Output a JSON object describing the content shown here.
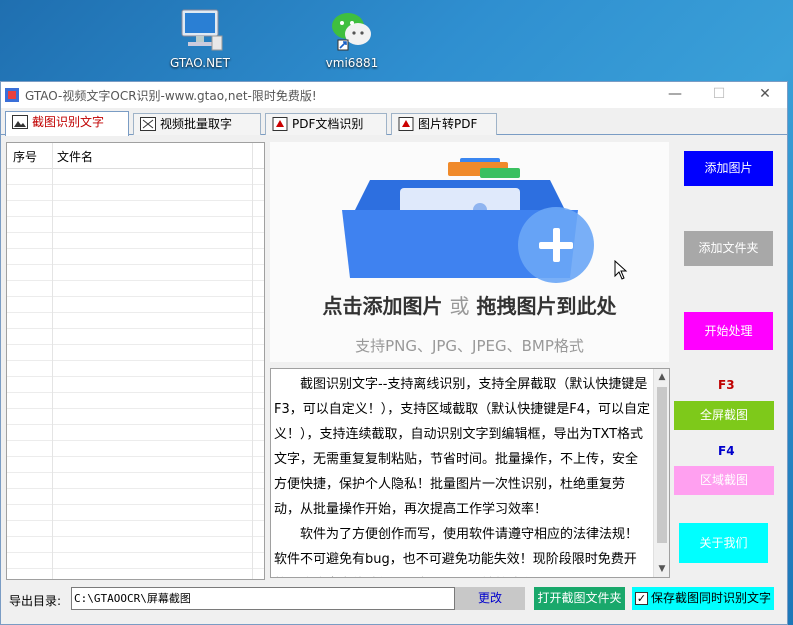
{
  "desktop": {
    "icons": [
      {
        "name": "computer-icon",
        "label": "GTAO.NET"
      },
      {
        "name": "wechat-icon",
        "label": "vmi6881"
      }
    ]
  },
  "window": {
    "title": "GTAO-视频文字OCR识别-www.gtao,net-限时免费版!",
    "controls": {
      "minimize": "—",
      "maximize": "☐",
      "close": "✕"
    }
  },
  "tabs": [
    {
      "label": "截图识别文字",
      "active": true
    },
    {
      "label": "视频批量取字",
      "active": false
    },
    {
      "label": "PDF文档识别",
      "active": false
    },
    {
      "label": "图片转PDF",
      "active": false
    }
  ],
  "filelist": {
    "col_index": "序号",
    "col_name": "文件名"
  },
  "dropzone": {
    "main_left": "点击添加图片",
    "main_or": "或",
    "main_right": "拖拽图片到此处",
    "sub": "支持PNG、JPG、JPEG、BMP格式"
  },
  "description": {
    "p1": "截图识别文字--支持离线识别，支持全屏截取（默认快捷键是F3，可以自定义！），支持区域截取（默认快捷键是F4，可以自定义！），支持连续截取，自动识别文字到编辑框，导出为TXT格式文字，无需重复复制粘贴，节省时间。批量操作，不上传，安全方便快捷，保护个人隐私！批量图片一次性识别，杜绝重复劳动，从批量操作开始，再次提高工作学习效率！",
    "p2": "软件为了方便创作而写，使用软件请遵守相应的法律法规！软件不可避免有bug，也不可避免功能失效！现阶段限时免费开放！欢迎大家体验使用，有问题可反馈给我们！"
  },
  "buttons": {
    "add_image": "添加图片",
    "add_folder": "添加文件夹",
    "start": "开始处理",
    "f3": "F3",
    "fullscreen": "全屏截图",
    "f4": "F4",
    "region": "区域截图",
    "about": "关于我们"
  },
  "bottom": {
    "export_label": "导出目录:",
    "export_path": "C:\\GTAOOCR\\屏幕截图",
    "change": "更改",
    "open_folder": "打开截图文件夹",
    "save_check_label": "保存截图同时识别文字",
    "save_checked": true,
    "check_mark": "✓"
  },
  "colors": {
    "add_image": "#0000ff",
    "add_folder": "#a8a8a8",
    "start": "#ff00ff",
    "fullscreen": "#7ec91a",
    "region": "#ffa0f0",
    "about": "#00ffff",
    "f3": "#c00000",
    "f4": "#0000cc"
  }
}
